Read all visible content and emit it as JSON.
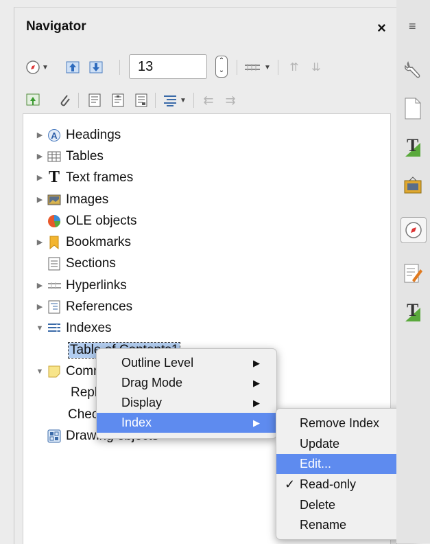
{
  "panel": {
    "title": "Navigator",
    "close_glyph": "×"
  },
  "toolbar": {
    "row1": [
      "navigation-icon",
      "dropdown-arrow",
      "promote-chapter-icon",
      "demote-chapter-icon",
      "drag-mode-icon",
      "dropdown-arrow",
      "move-up-icon",
      "move-down-icon"
    ],
    "page_number": "13",
    "row2": [
      "toggle-master-view-icon",
      "reminder-icon",
      "header-icon",
      "footer-icon",
      "anchor-endnote-icon",
      "heading-levels-icon",
      "dropdown-arrow",
      "promote-level-icon",
      "demote-level-icon"
    ]
  },
  "tree": {
    "items": [
      {
        "label": "Headings",
        "icon": "headings-icon",
        "expander": "▶"
      },
      {
        "label": "Tables",
        "icon": "tables-icon",
        "expander": "▶"
      },
      {
        "label": "Text frames",
        "icon": "text-frames-icon",
        "expander": "▶"
      },
      {
        "label": "Images",
        "icon": "images-icon",
        "expander": "▶"
      },
      {
        "label": "OLE objects",
        "icon": "ole-objects-icon",
        "expander": ""
      },
      {
        "label": "Bookmarks",
        "icon": "bookmarks-icon",
        "expander": "▶"
      },
      {
        "label": "Sections",
        "icon": "sections-icon",
        "expander": ""
      },
      {
        "label": "Hyperlinks",
        "icon": "hyperlinks-icon",
        "expander": "▶"
      },
      {
        "label": "References",
        "icon": "references-icon",
        "expander": "▶"
      },
      {
        "label": "Indexes",
        "icon": "indexes-icon",
        "expander": "▼"
      },
      {
        "label": "Table of Contents1",
        "icon": "",
        "expander": ""
      },
      {
        "label": "Comments",
        "icon": "comments-icon",
        "expander": "▼"
      },
      {
        "label": "Reply",
        "icon": "",
        "expander": ""
      },
      {
        "label": "Check",
        "icon": "",
        "expander": ""
      },
      {
        "label": "Drawing objects",
        "icon": "drawing-objects-icon",
        "expander": ""
      }
    ],
    "partial": {
      "toc": "Tabl",
      "comments": "Con",
      "reply": "Rep",
      "check": "Che",
      "drawing": "Drawing objects",
      "reply_tail": "."
    }
  },
  "context_menu": {
    "items": [
      {
        "label": "Outline Level",
        "submenu": "▶"
      },
      {
        "label": "Drag Mode",
        "submenu": "▶"
      },
      {
        "label": "Display",
        "submenu": "▶"
      },
      {
        "label": "Index",
        "submenu": "▶"
      }
    ]
  },
  "submenu": {
    "items": [
      {
        "label": "Remove Index",
        "check": ""
      },
      {
        "label": "Update",
        "check": ""
      },
      {
        "label": "Edit...",
        "check": ""
      },
      {
        "label": "Read-only",
        "check": "✓"
      },
      {
        "label": "Delete",
        "check": ""
      },
      {
        "label": "Rename",
        "check": ""
      }
    ]
  },
  "sidebar": {
    "menu_glyph": "≡",
    "icons": [
      "properties-icon",
      "page-icon",
      "styles-icon",
      "gallery-icon",
      "navigator-icon",
      "manage-changes-icon",
      "design-icon"
    ]
  },
  "colors": {
    "accent": "#5e8bef",
    "selection": "#b2cdf0"
  }
}
